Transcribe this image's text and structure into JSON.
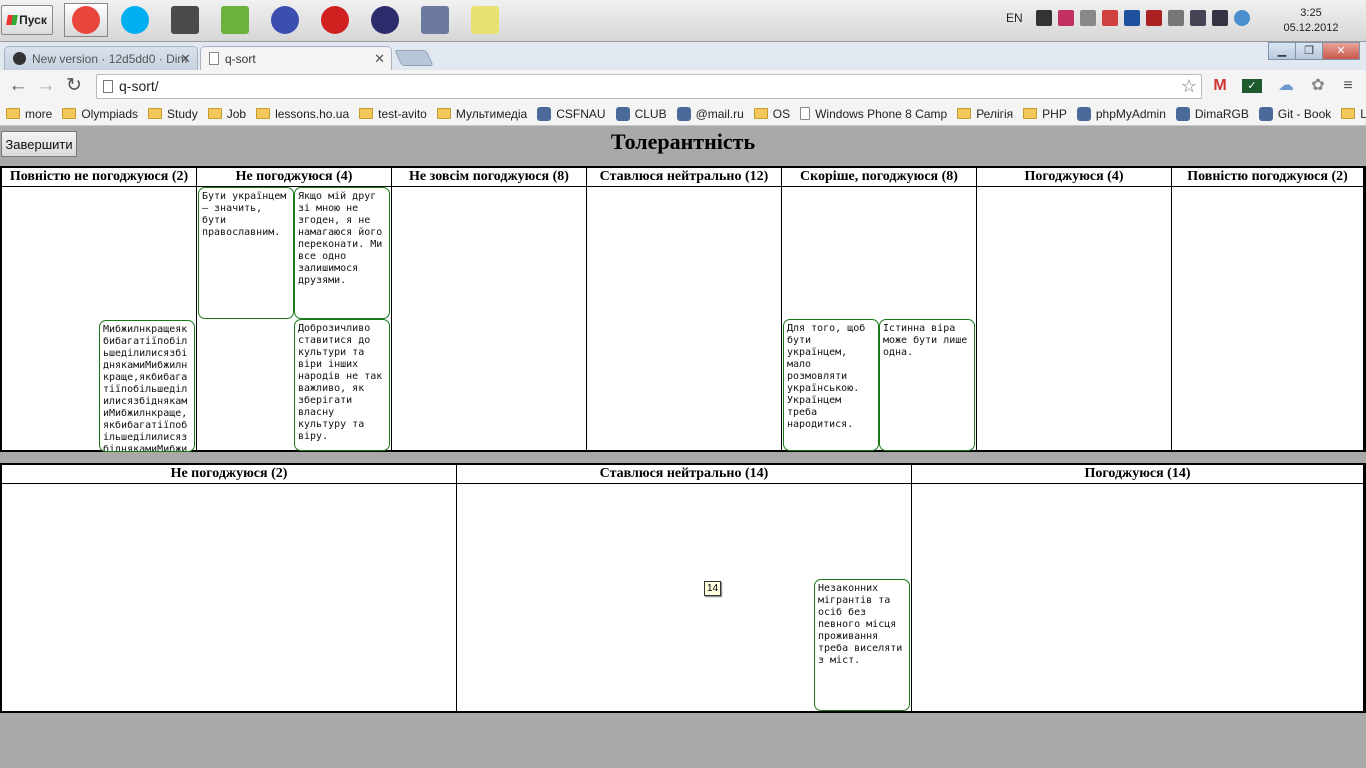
{
  "taskbar": {
    "start_label": "Пуск",
    "lang": "EN",
    "time": "3:25",
    "date": "05.12.2012",
    "apps": [
      {
        "name": "chrome",
        "color": "#e8453c"
      },
      {
        "name": "skype",
        "color": "#00aff0"
      },
      {
        "name": "sublime",
        "color": "#4a4a4a"
      },
      {
        "name": "notepad-plus",
        "color": "#6bb13c"
      },
      {
        "name": "infinity",
        "color": "#3c4fb0"
      },
      {
        "name": "library",
        "color": "#d02020"
      },
      {
        "name": "eclipse",
        "color": "#2c2c6c"
      },
      {
        "name": "php-editor",
        "color": "#6c7aa0"
      },
      {
        "name": "sticky-notes",
        "color": "#e8e070"
      }
    ]
  },
  "browser": {
    "tabs": [
      {
        "label": "New version · 12d5dd0 · Dim",
        "active": false
      },
      {
        "label": "q-sort",
        "active": true
      }
    ],
    "url": "q-sort/",
    "bookmarks": [
      {
        "label": "more",
        "type": "folder"
      },
      {
        "label": "Olympiads",
        "type": "folder"
      },
      {
        "label": "Study",
        "type": "folder"
      },
      {
        "label": "Job",
        "type": "folder"
      },
      {
        "label": "lessons.ho.ua",
        "type": "folder"
      },
      {
        "label": "test-avito",
        "type": "folder"
      },
      {
        "label": "Мультимедіа",
        "type": "folder"
      },
      {
        "label": "CSFNAU",
        "type": "site"
      },
      {
        "label": "CLUB",
        "type": "site"
      },
      {
        "label": "@mail.ru",
        "type": "site"
      },
      {
        "label": "OS",
        "type": "folder"
      },
      {
        "label": "Windows Phone 8 Camp",
        "type": "page"
      },
      {
        "label": "Релігія",
        "type": "folder"
      },
      {
        "label": "PHP",
        "type": "folder"
      },
      {
        "label": "phpMyAdmin",
        "type": "site"
      },
      {
        "label": "DimaRGB",
        "type": "site"
      },
      {
        "label": "Git - Book",
        "type": "site"
      },
      {
        "label": "L",
        "type": "folder"
      }
    ]
  },
  "page": {
    "finish_button": "Завершити",
    "title": "Толерантність",
    "grid_top": {
      "columns": [
        "Повністю не погоджуюся (2)",
        "Не погоджуюся (4)",
        "Не зовсім погоджуюся (8)",
        "Ставлюся нейтрально (12)",
        "Скоріше, погоджуюся (8)",
        "Погоджуюся (4)",
        "Повністю погоджуюся (2)"
      ],
      "cards": [
        {
          "text": "МибжилнкращеякбибагатіїпобільшеділилисязбіднякамиМибжилнкраще,якбибагатіїпобільшеділилисязбіднякамиМибжилнкраще,якбибагатіїпобільшеділилисязбіднякамиМибжилнкраще",
          "wrap": false
        },
        {
          "text": "Бути українцем – значить, бути православним.",
          "wrap": true
        },
        {
          "text": "Якщо мій друг зі мною не згоден, я не намагаюся його переконати. Ми все одно залишимося друзями.",
          "wrap": true
        },
        {
          "text": "Доброзичливо ставитися до культури та віри інших народів не так важливо, як зберігати власну культуру та віру.",
          "wrap": true
        },
        {
          "text": "Для того, щоб бути українцем, мало розмовляти українською. Українцем треба народитися.",
          "wrap": true
        },
        {
          "text": "Істинна віра може бути лише одна.",
          "wrap": true
        }
      ]
    },
    "grid_bottom": {
      "columns": [
        "Не погоджуюся (2)",
        "Ставлюся нейтрально (14)",
        "Погоджуюся (14)"
      ],
      "cards": [
        {
          "text": "Незаконних мігрантів та осіб без певного місця проживання треба виселяти з міст.",
          "wrap": true
        }
      ],
      "badge": "14"
    }
  }
}
